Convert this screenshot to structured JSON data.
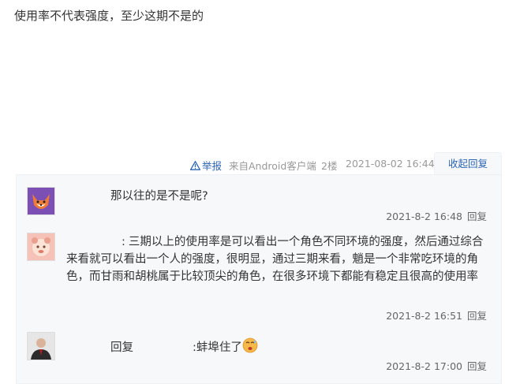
{
  "post": {
    "text": "使用率不代表强度，至少这期不是的"
  },
  "tail": {
    "report_label": "举报",
    "from_label": "来自Android客户端",
    "floor": "2楼",
    "timestamp": "2021-08-02 16:44",
    "toggle_label": "收起回复"
  },
  "replies": [
    {
      "username": "",
      "separator": "",
      "text": "那以往的是不是呢?",
      "time": "2021-8-2 16:48",
      "reply_label": "回复"
    },
    {
      "username": "",
      "separator": ":",
      "text": "三期以上的使用率是可以看出一个角色不同环境的强度，然后通过综合来看就可以看出一个人的强度，很明显，通过三期来看，魈是一个非常吃环境的角色，而甘雨和胡桃属于比较顶尖的角色，在很多环境下都能有稳定且很高的使用率",
      "time": "2021-8-2 16:51",
      "reply_label": "回复"
    },
    {
      "username": "",
      "reply_word": "回复",
      "target": "",
      "separator": ":",
      "text": "蚌埠住了",
      "time": "2021-8-2 17:00",
      "reply_label": "回复"
    }
  ]
}
